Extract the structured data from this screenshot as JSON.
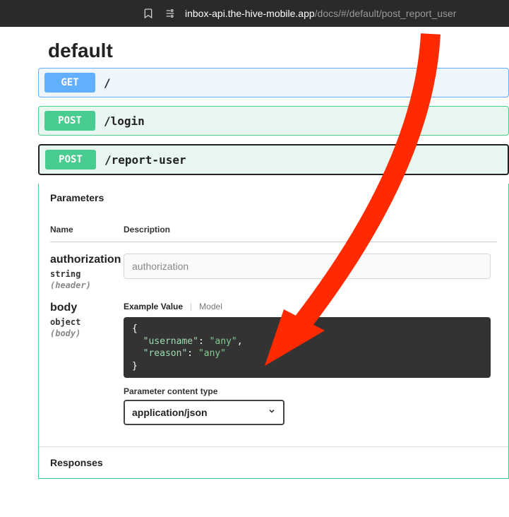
{
  "browser": {
    "url_main": "inbox-api.the-hive-mobile.app",
    "url_path": "/docs/#/default/post_report_user"
  },
  "page_title": "default",
  "endpoints": [
    {
      "method": "GET",
      "path": "/"
    },
    {
      "method": "POST",
      "path": "/login"
    },
    {
      "method": "POST",
      "path": "/report-user"
    }
  ],
  "sections": {
    "parameters": "Parameters",
    "responses": "Responses"
  },
  "table_headers": {
    "name": "Name",
    "description": "Description"
  },
  "params": [
    {
      "name": "authorization",
      "type": "string",
      "loc": "(header)",
      "placeholder": "authorization"
    },
    {
      "name": "body",
      "type": "object",
      "loc": "(body)"
    }
  ],
  "example_tabs": {
    "active": "Example Value",
    "other": "Model"
  },
  "example_body": {
    "username": "any",
    "reason": "any"
  },
  "content_type": {
    "label": "Parameter content type",
    "value": "application/json"
  }
}
